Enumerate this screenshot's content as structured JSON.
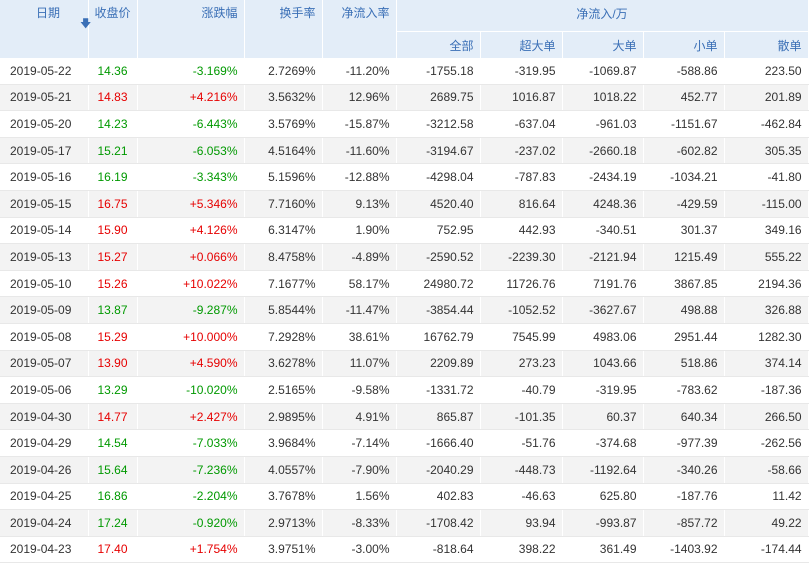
{
  "header": {
    "date": "日期",
    "close": "收盘价",
    "change": "涨跌幅",
    "turnover": "换手率",
    "net_inflow_rate": "净流入率",
    "net_inflow_group": "净流入/万",
    "all": "全部",
    "super_large": "超大单",
    "large": "大单",
    "small": "小单",
    "retail": "散单"
  },
  "colors": {
    "up": "#e60000",
    "down": "#009900",
    "header_bg": "#e3edf8",
    "header_text": "#3a6fb6"
  },
  "rows": [
    {
      "date": "2019-05-22",
      "close": "14.36",
      "change": "-3.169%",
      "turnover": "2.7269%",
      "rate": "-11.20%",
      "all": "-1755.18",
      "super": "-319.95",
      "large": "-1069.87",
      "small": "-588.86",
      "retail": "223.50",
      "dir": "down"
    },
    {
      "date": "2019-05-21",
      "close": "14.83",
      "change": "+4.216%",
      "turnover": "3.5632%",
      "rate": "12.96%",
      "all": "2689.75",
      "super": "1016.87",
      "large": "1018.22",
      "small": "452.77",
      "retail": "201.89",
      "dir": "up"
    },
    {
      "date": "2019-05-20",
      "close": "14.23",
      "change": "-6.443%",
      "turnover": "3.5769%",
      "rate": "-15.87%",
      "all": "-3212.58",
      "super": "-637.04",
      "large": "-961.03",
      "small": "-1151.67",
      "retail": "-462.84",
      "dir": "down"
    },
    {
      "date": "2019-05-17",
      "close": "15.21",
      "change": "-6.053%",
      "turnover": "4.5164%",
      "rate": "-11.60%",
      "all": "-3194.67",
      "super": "-237.02",
      "large": "-2660.18",
      "small": "-602.82",
      "retail": "305.35",
      "dir": "down"
    },
    {
      "date": "2019-05-16",
      "close": "16.19",
      "change": "-3.343%",
      "turnover": "5.1596%",
      "rate": "-12.88%",
      "all": "-4298.04",
      "super": "-787.83",
      "large": "-2434.19",
      "small": "-1034.21",
      "retail": "-41.80",
      "dir": "down"
    },
    {
      "date": "2019-05-15",
      "close": "16.75",
      "change": "+5.346%",
      "turnover": "7.7160%",
      "rate": "9.13%",
      "all": "4520.40",
      "super": "816.64",
      "large": "4248.36",
      "small": "-429.59",
      "retail": "-115.00",
      "dir": "up"
    },
    {
      "date": "2019-05-14",
      "close": "15.90",
      "change": "+4.126%",
      "turnover": "6.3147%",
      "rate": "1.90%",
      "all": "752.95",
      "super": "442.93",
      "large": "-340.51",
      "small": "301.37",
      "retail": "349.16",
      "dir": "up"
    },
    {
      "date": "2019-05-13",
      "close": "15.27",
      "change": "+0.066%",
      "turnover": "8.4758%",
      "rate": "-4.89%",
      "all": "-2590.52",
      "super": "-2239.30",
      "large": "-2121.94",
      "small": "1215.49",
      "retail": "555.22",
      "dir": "up"
    },
    {
      "date": "2019-05-10",
      "close": "15.26",
      "change": "+10.022%",
      "turnover": "7.1677%",
      "rate": "58.17%",
      "all": "24980.72",
      "super": "11726.76",
      "large": "7191.76",
      "small": "3867.85",
      "retail": "2194.36",
      "dir": "up"
    },
    {
      "date": "2019-05-09",
      "close": "13.87",
      "change": "-9.287%",
      "turnover": "5.8544%",
      "rate": "-11.47%",
      "all": "-3854.44",
      "super": "-1052.52",
      "large": "-3627.67",
      "small": "498.88",
      "retail": "326.88",
      "dir": "down"
    },
    {
      "date": "2019-05-08",
      "close": "15.29",
      "change": "+10.000%",
      "turnover": "7.2928%",
      "rate": "38.61%",
      "all": "16762.79",
      "super": "7545.99",
      "large": "4983.06",
      "small": "2951.44",
      "retail": "1282.30",
      "dir": "up"
    },
    {
      "date": "2019-05-07",
      "close": "13.90",
      "change": "+4.590%",
      "turnover": "3.6278%",
      "rate": "11.07%",
      "all": "2209.89",
      "super": "273.23",
      "large": "1043.66",
      "small": "518.86",
      "retail": "374.14",
      "dir": "up"
    },
    {
      "date": "2019-05-06",
      "close": "13.29",
      "change": "-10.020%",
      "turnover": "2.5165%",
      "rate": "-9.58%",
      "all": "-1331.72",
      "super": "-40.79",
      "large": "-319.95",
      "small": "-783.62",
      "retail": "-187.36",
      "dir": "down"
    },
    {
      "date": "2019-04-30",
      "close": "14.77",
      "change": "+2.427%",
      "turnover": "2.9895%",
      "rate": "4.91%",
      "all": "865.87",
      "super": "-101.35",
      "large": "60.37",
      "small": "640.34",
      "retail": "266.50",
      "dir": "up"
    },
    {
      "date": "2019-04-29",
      "close": "14.54",
      "change": "-7.033%",
      "turnover": "3.9684%",
      "rate": "-7.14%",
      "all": "-1666.40",
      "super": "-51.76",
      "large": "-374.68",
      "small": "-977.39",
      "retail": "-262.56",
      "dir": "down"
    },
    {
      "date": "2019-04-26",
      "close": "15.64",
      "change": "-7.236%",
      "turnover": "4.0557%",
      "rate": "-7.90%",
      "all": "-2040.29",
      "super": "-448.73",
      "large": "-1192.64",
      "small": "-340.26",
      "retail": "-58.66",
      "dir": "down"
    },
    {
      "date": "2019-04-25",
      "close": "16.86",
      "change": "-2.204%",
      "turnover": "3.7678%",
      "rate": "1.56%",
      "all": "402.83",
      "super": "-46.63",
      "large": "625.80",
      "small": "-187.76",
      "retail": "11.42",
      "dir": "down"
    },
    {
      "date": "2019-04-24",
      "close": "17.24",
      "change": "-0.920%",
      "turnover": "2.9713%",
      "rate": "-8.33%",
      "all": "-1708.42",
      "super": "93.94",
      "large": "-993.87",
      "small": "-857.72",
      "retail": "49.22",
      "dir": "down"
    },
    {
      "date": "2019-04-23",
      "close": "17.40",
      "change": "+1.754%",
      "turnover": "3.9751%",
      "rate": "-3.00%",
      "all": "-818.64",
      "super": "398.22",
      "large": "361.49",
      "small": "-1403.92",
      "retail": "-174.44",
      "dir": "up"
    }
  ]
}
